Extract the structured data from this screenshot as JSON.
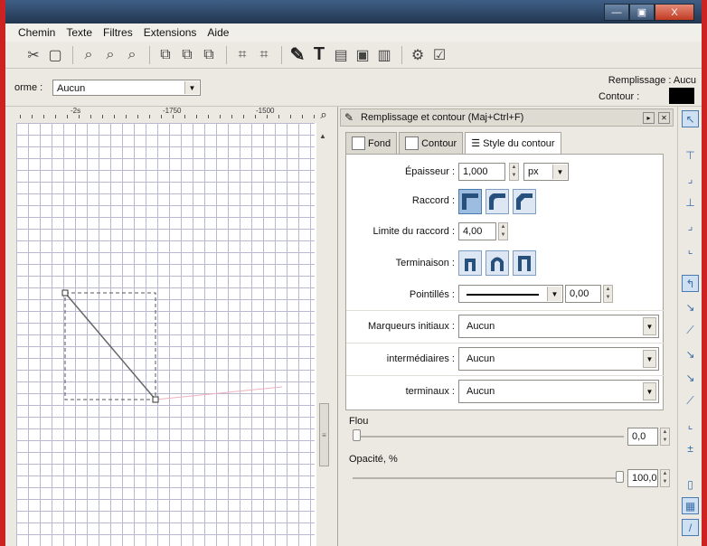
{
  "menu": [
    "Chemin",
    "Texte",
    "Filtres",
    "Extensions",
    "Aide"
  ],
  "window_buttons": {
    "minimize": "—",
    "maximize": "▣",
    "close": "X"
  },
  "options": {
    "form_label": "orme :",
    "form_value": "Aucun",
    "fill_label": "Remplissage : Aucu",
    "stroke_label": "Contour :"
  },
  "ruler": {
    "marks": [
      "-2s",
      "-1750",
      "-1500"
    ]
  },
  "dialog": {
    "title": "Remplissage et contour (Maj+Ctrl+F)",
    "tabs": [
      "Fond",
      "Contour",
      "Style du contour"
    ],
    "width_label": "Épaisseur :",
    "width_value": "1,000",
    "unit": "px",
    "join_label": "Raccord :",
    "miter_label": "Limite du raccord :",
    "miter_value": "4,00",
    "cap_label": "Terminaison :",
    "dash_label": "Pointillés :",
    "dash_offset": "0,00",
    "markers_start_label": "Marqueurs initiaux :",
    "markers_start_value": "Aucun",
    "markers_mid_label": "intermédiaires :",
    "markers_mid_value": "Aucun",
    "markers_end_label": "terminaux :",
    "markers_end_value": "Aucun",
    "blur_label": "Flou",
    "blur_value": "0,0",
    "blur_level": 0,
    "opacity_label": "Opacité, %",
    "opacity_value": "100,0",
    "opacity_level": 100
  },
  "colors": {
    "accent": "#4a7bb0",
    "stroke_swatch": "#000000",
    "selection_line": "#f0b0c0"
  }
}
